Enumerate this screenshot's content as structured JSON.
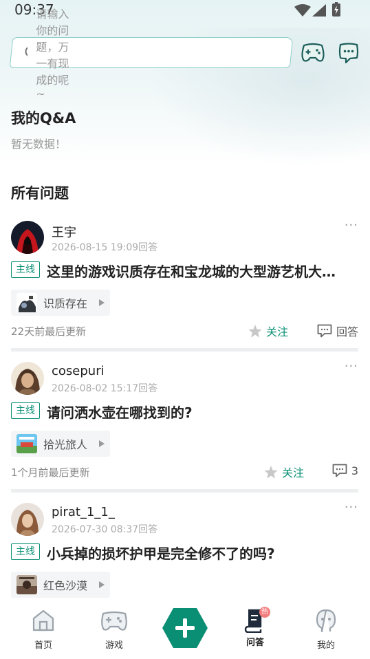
{
  "status": {
    "time": "09:37"
  },
  "search": {
    "placeholder": "请输入你的问题，万一有现成的呢~"
  },
  "my_qa": {
    "title": "我的Q&A",
    "empty": "暂无数据！"
  },
  "all": {
    "title": "所有问题"
  },
  "questions": [
    {
      "user": "王宇",
      "date": "2026-08-15 19:09回答",
      "tag": "主线",
      "title": "这里的游戏识质存在和宝龙城的大型游艺机大…",
      "game": "识质存在",
      "updated": "22天前最后更新",
      "follow": "关注",
      "reply": "回答"
    },
    {
      "user": "cosepuri",
      "date": "2026-08-02 15:17回答",
      "tag": "主线",
      "title": "请问洒水壶在哪找到的?",
      "game": "拾光旅人",
      "updated": "1个月前最后更新",
      "follow": "关注",
      "reply": "3"
    },
    {
      "user": "pirat_1_1_",
      "date": "2026-07-30 08:37回答",
      "tag": "主线",
      "title": "小兵掉的损坏护甲是完全修不了的吗?",
      "game": "红色沙漠"
    }
  ],
  "more": "···",
  "tabs": {
    "home": "首页",
    "games": "游戏",
    "qa": "问答",
    "me": "我的",
    "hot_badge": "热"
  },
  "colors": {
    "accent": "#0a8f74"
  }
}
